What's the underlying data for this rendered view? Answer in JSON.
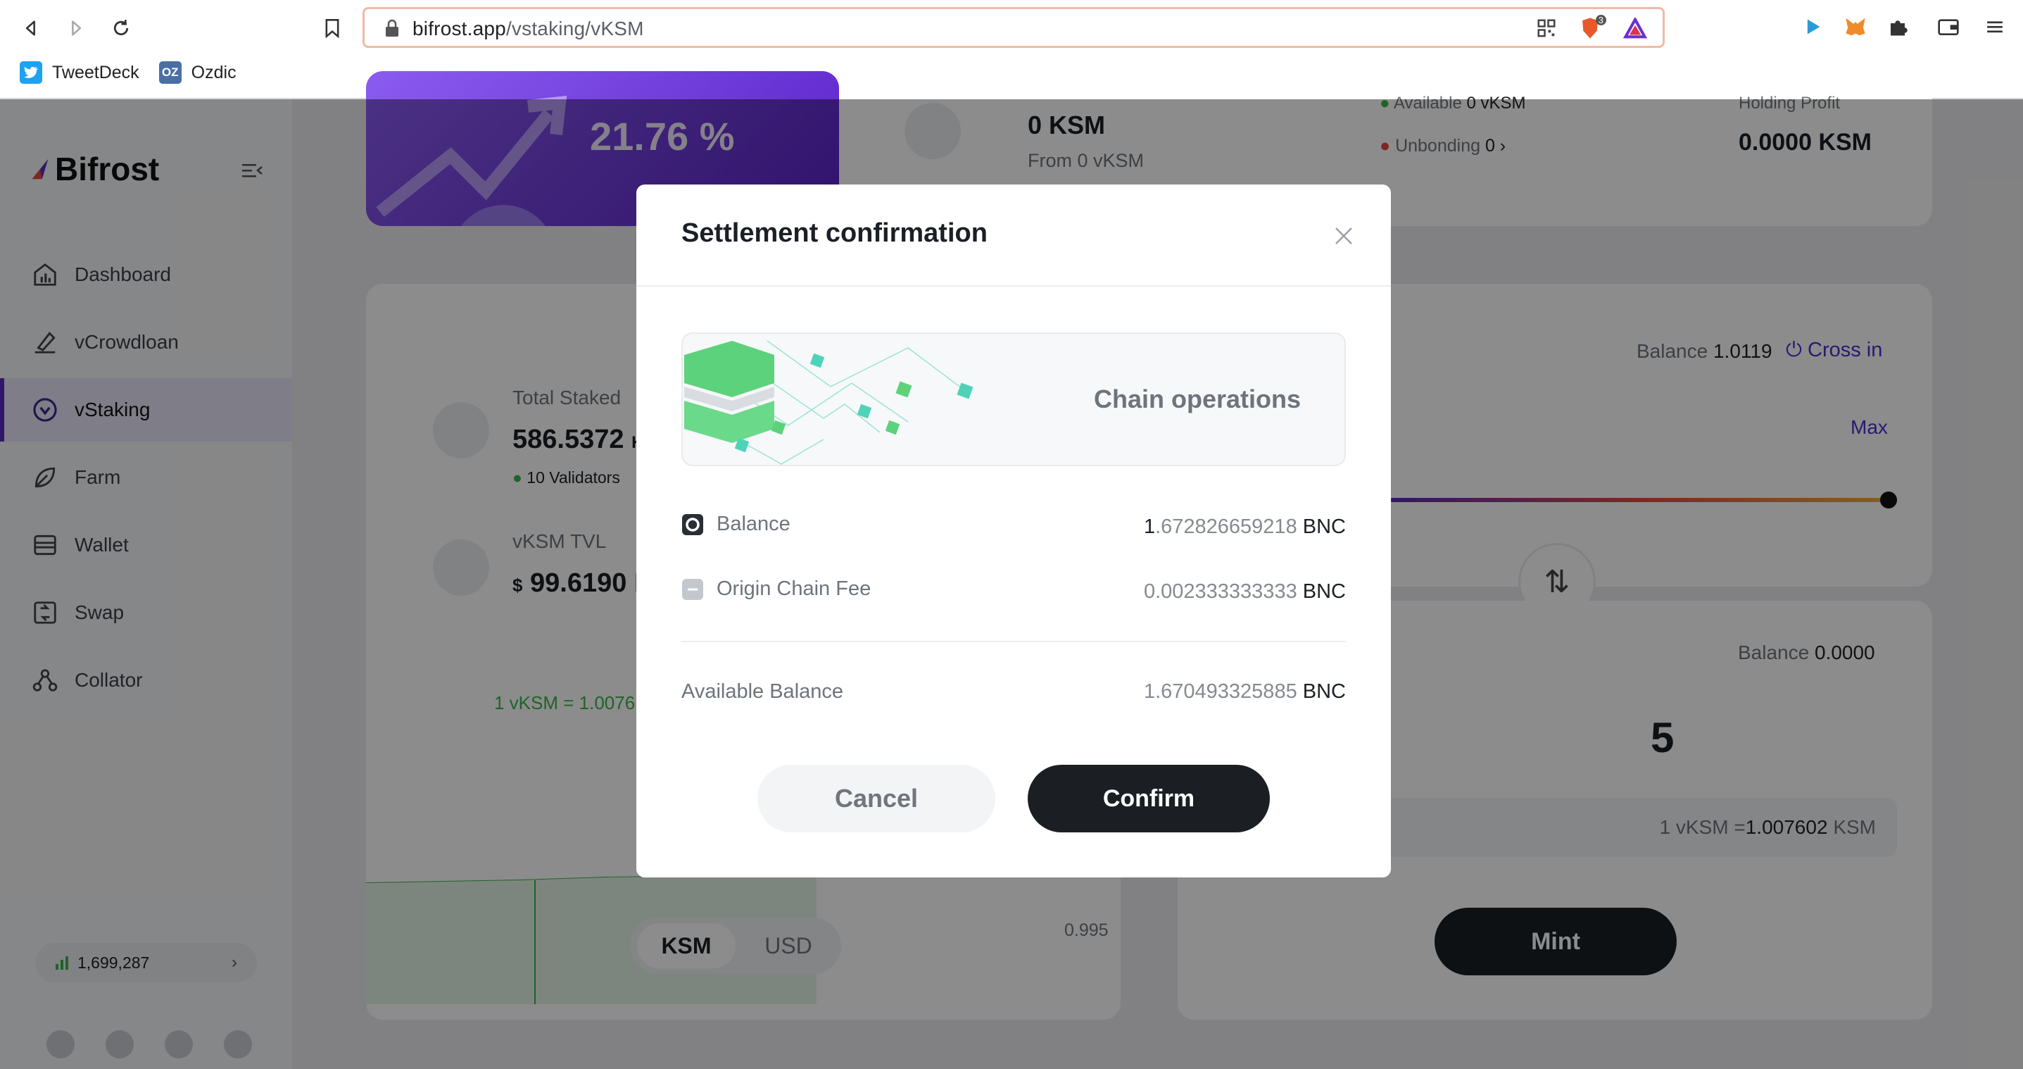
{
  "browser": {
    "url_domain": "bifrost.app",
    "url_path": "/vstaking/vKSM",
    "brave_badge": "3",
    "bookmarks": [
      {
        "label": "TweetDeck",
        "icon": "twitter-icon"
      },
      {
        "label": "Ozdic",
        "icon": "oz-icon",
        "icon_text": "OZ"
      }
    ]
  },
  "sidebar": {
    "logo": "Bifrost",
    "items": [
      {
        "label": "Dashboard",
        "icon": "dashboard-icon"
      },
      {
        "label": "vCrowdloan",
        "icon": "crowdloan-icon"
      },
      {
        "label": "vStaking",
        "icon": "vstaking-icon",
        "active": true
      },
      {
        "label": "Farm",
        "icon": "farm-icon"
      },
      {
        "label": "Wallet",
        "icon": "wallet-icon"
      },
      {
        "label": "Swap",
        "icon": "swap-icon"
      },
      {
        "label": "Collator",
        "icon": "collator-icon"
      }
    ],
    "block_height": "1,699,287"
  },
  "background": {
    "apy": "21.76 %",
    "staked_value": "0 KSM",
    "staked_from": "From 0 vKSM",
    "available_label": "Available",
    "available_value": "0 vKSM",
    "unbonding_label": "Unbonding",
    "unbonding_value": "0 ›",
    "holding_profit_label": "Holding Profit",
    "holding_profit_value": "0.0000 KSM",
    "total_staked_label": "Total Staked",
    "total_staked_value": "586.5372",
    "total_staked_unit": "K",
    "validators": "10 Validators",
    "tvl_label": "vKSM TVL",
    "tvl_currency": "$",
    "tvl_value": "99.6190",
    "tvl_unit": "M",
    "rate_text": "1 vKSM = 1.0076",
    "axis_tick": "0.995",
    "toggle_ksm": "KSM",
    "toggle_usd": "USD",
    "balance_label": "Balance",
    "balance_value": "1.0119",
    "cross_in": "Cross in",
    "max": "Max",
    "balance2_label": "Balance",
    "balance2_value": "0.0000",
    "amount_partial": "5",
    "rate_box_prefix": "1 vKSM =",
    "rate_box_value": "1.007602",
    "rate_box_unit": "KSM",
    "mint": "Mint"
  },
  "modal": {
    "title": "Settlement confirmation",
    "chain_label": "Chain operations",
    "balance_label": "Balance",
    "balance_lead": "1",
    "balance_rest": ".672826659218",
    "balance_unit": "BNC",
    "fee_label": "Origin Chain Fee",
    "fee_value": "0.002333333333",
    "fee_unit": "BNC",
    "available_label": "Available Balance",
    "available_value": "1.670493325885",
    "available_unit": "BNC",
    "cancel": "Cancel",
    "confirm": "Confirm"
  },
  "colors": {
    "accent": "#5a2bbf",
    "link": "#4c2fd0",
    "green": "#3ab54a"
  }
}
